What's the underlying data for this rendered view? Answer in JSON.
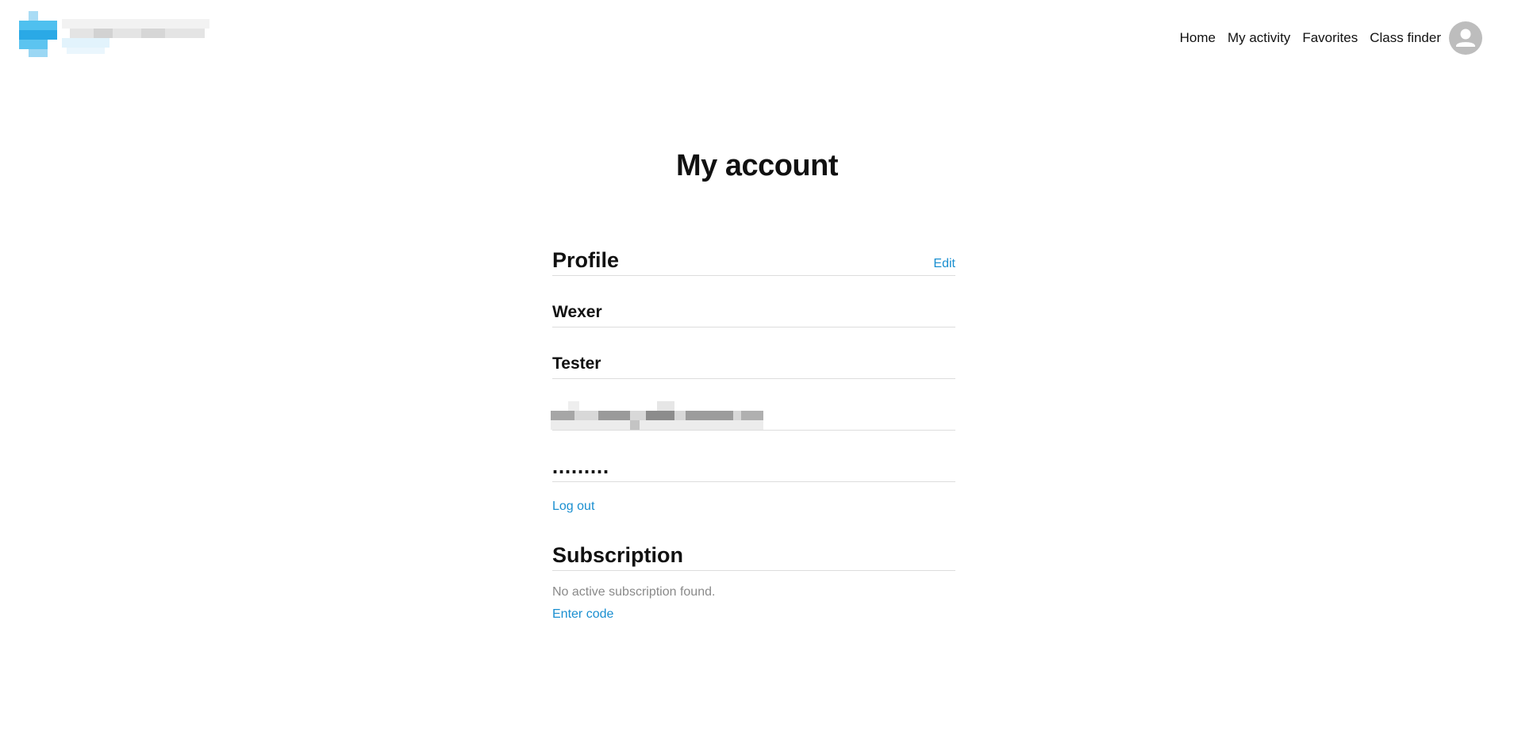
{
  "header": {
    "logo_name": "brand-logo",
    "nav": [
      "Home",
      "My activity",
      "Favorites",
      "Class finder"
    ],
    "avatar_icon": "user-icon"
  },
  "page": {
    "title": "My account"
  },
  "profile": {
    "title": "Profile",
    "edit_label": "Edit",
    "first_name": "Wexer",
    "last_name": "Tester",
    "password_mask": "․․․․․․․․․",
    "logout_label": "Log out"
  },
  "subscription": {
    "title": "Subscription",
    "status_text": "No active subscription found.",
    "enter_code_label": "Enter code"
  },
  "colors": {
    "accent": "#1a8fd0",
    "logo_blue": "#3bb3ea",
    "avatar_bg": "#bdbdbd",
    "muted_text": "#8a8a8a"
  }
}
